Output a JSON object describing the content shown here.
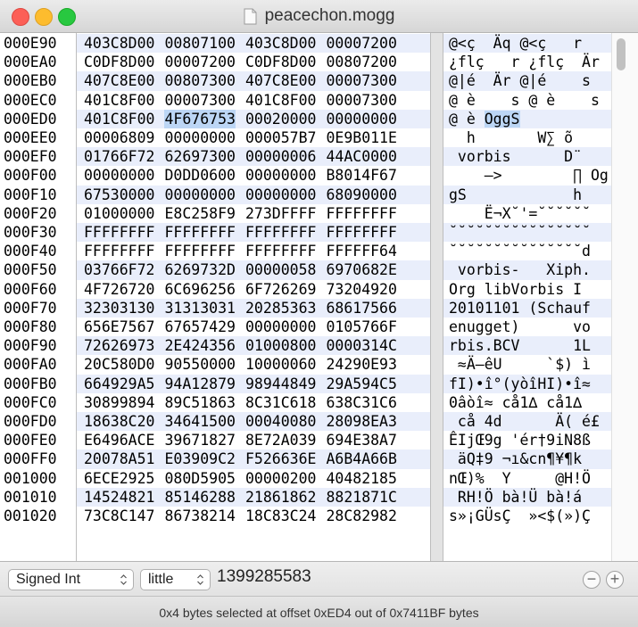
{
  "window": {
    "title": "peacechon.mogg"
  },
  "rows": [
    {
      "offset": "000E90",
      "hex": [
        "403C8D00",
        "00807100",
        "403C8D00",
        "00007200"
      ],
      "text": "@<ç  Äq @<ç   r"
    },
    {
      "offset": "000EA0",
      "hex": [
        "C0DF8D00",
        "00007200",
        "C0DF8D00",
        "00807200"
      ],
      "text": "¿flç   r ¿flç  Är"
    },
    {
      "offset": "000EB0",
      "hex": [
        "407C8E00",
        "00807300",
        "407C8E00",
        "00007300"
      ],
      "text": "@|é  Är @|é    s"
    },
    {
      "offset": "000EC0",
      "hex": [
        "401C8F00",
        "00007300",
        "401C8F00",
        "00007300"
      ],
      "text": "@ è    s @ è    s"
    },
    {
      "offset": "000ED0",
      "hex": [
        "401C8F00",
        "4F676753",
        "00020000",
        "00000000"
      ],
      "text": "@ è OggS"
    },
    {
      "offset": "000EE0",
      "hex": [
        "00006809",
        "00000000",
        "000057B7",
        "0E9B011E"
      ],
      "text": "  h       W∑ õ"
    },
    {
      "offset": "000EF0",
      "hex": [
        "01766F72",
        "62697300",
        "00000006",
        "44AC0000"
      ],
      "text": " vorbis      D¨"
    },
    {
      "offset": "000F00",
      "hex": [
        "00000000",
        "D0DD0600",
        "00000000",
        "B8014F67"
      ],
      "text": "    –>        ∏ Og"
    },
    {
      "offset": "000F10",
      "hex": [
        "67530000",
        "00000000",
        "00000000",
        "68090000"
      ],
      "text": "gS            h"
    },
    {
      "offset": "000F20",
      "hex": [
        "01000000",
        "E8C258F9",
        "273DFFFF",
        "FFFFFFFF"
      ],
      "text": "    Ë¬X˘'=˘˘˘˘˘˘"
    },
    {
      "offset": "000F30",
      "hex": [
        "FFFFFFFF",
        "FFFFFFFF",
        "FFFFFFFF",
        "FFFFFFFF"
      ],
      "text": "˘˘˘˘˘˘˘˘˘˘˘˘˘˘˘˘"
    },
    {
      "offset": "000F40",
      "hex": [
        "FFFFFFFF",
        "FFFFFFFF",
        "FFFFFFFF",
        "FFFFFF64"
      ],
      "text": "˘˘˘˘˘˘˘˘˘˘˘˘˘˘˘d"
    },
    {
      "offset": "000F50",
      "hex": [
        "03766F72",
        "6269732D",
        "00000058",
        "6970682E"
      ],
      "text": " vorbis-   Xiph."
    },
    {
      "offset": "000F60",
      "hex": [
        "4F726720",
        "6C696256",
        "6F726269",
        "73204920"
      ],
      "text": "Org libVorbis I "
    },
    {
      "offset": "000F70",
      "hex": [
        "32303130",
        "31313031",
        "20285363",
        "68617566"
      ],
      "text": "20101101 (Schauf"
    },
    {
      "offset": "000F80",
      "hex": [
        "656E7567",
        "67657429",
        "00000000",
        "0105766F"
      ],
      "text": "enugget)      vo"
    },
    {
      "offset": "000F90",
      "hex": [
        "72626973",
        "2E424356",
        "01000800",
        "0000314C"
      ],
      "text": "rbis.BCV      1L"
    },
    {
      "offset": "000FA0",
      "hex": [
        "20C580D0",
        "90550000",
        "10000060",
        "24290E93"
      ],
      "text": " ≈Ä–êU     `$) ì"
    },
    {
      "offset": "000FB0",
      "hex": [
        "664929A5",
        "94A12879",
        "98944849",
        "29A594C5"
      ],
      "text": "fI)•î°(yòîHI)•î≈"
    },
    {
      "offset": "000FC0",
      "hex": [
        "30899894",
        "89C51863",
        "8C31C618",
        "638C31C6"
      ],
      "text": "0âòî≈ cå1∆ cå1∆"
    },
    {
      "offset": "000FD0",
      "hex": [
        "18638C20",
        "34641500",
        "00040080",
        "28098EA3"
      ],
      "text": " cå 4d      Ä( é£"
    },
    {
      "offset": "000FE0",
      "hex": [
        "E6496ACE",
        "39671827",
        "8E72A039",
        "694E38A7"
      ],
      "text": "ÊIjŒ9g 'ér†9iN8ß"
    },
    {
      "offset": "000FF0",
      "hex": [
        "20078A51",
        "E03909C2",
        "F526636E",
        "A6B4A66B"
      ],
      "text": " äQ‡9 ¬ı&cn¶¥¶k"
    },
    {
      "offset": "001000",
      "hex": [
        "6ECE2925",
        "080D5905",
        "00000200",
        "40482185"
      ],
      "text": "nŒ)%  Y     @H!Ö"
    },
    {
      "offset": "001010",
      "hex": [
        "14524821",
        "85146288",
        "21861862",
        "8821871C"
      ],
      "text": " RH!Ö bà!Ü bà!á"
    },
    {
      "offset": "001020",
      "hex": [
        "73C8C147",
        "86738214",
        "18C83C24",
        "28C82982"
      ],
      "text": "s»¡GÜsÇ  »<$(»)Ç"
    }
  ],
  "selection": {
    "row_index": 4,
    "hex_cell_index": 1,
    "text_chars": "OggS"
  },
  "inspector": {
    "type_label": "Signed Int",
    "endian_label": "little",
    "value": "1399285583",
    "minus_label": "−",
    "plus_label": "+"
  },
  "status": {
    "text": "0x4 bytes selected at offset 0xED4 out of 0x7411BF bytes"
  }
}
